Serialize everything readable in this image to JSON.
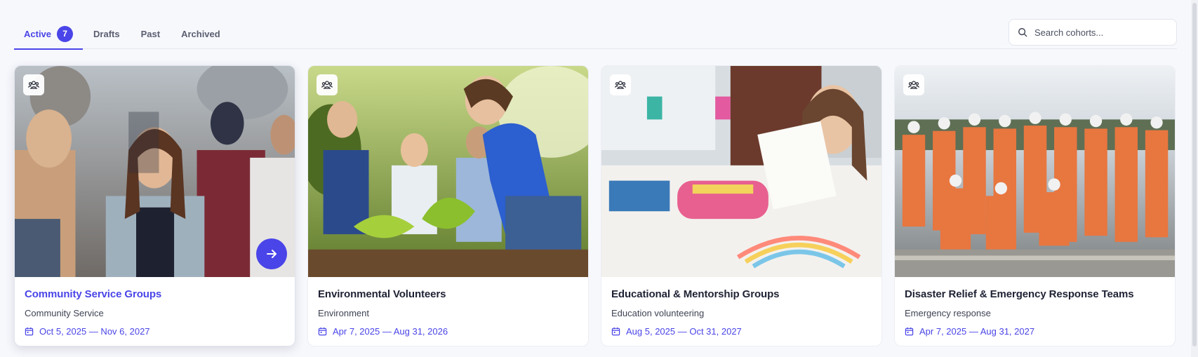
{
  "tabs": [
    {
      "label": "Active",
      "count": "7",
      "active": true
    },
    {
      "label": "Drafts"
    },
    {
      "label": "Past"
    },
    {
      "label": "Archived"
    }
  ],
  "search": {
    "placeholder": "Search cohorts...",
    "icon": "search-icon"
  },
  "cards": [
    {
      "title": "Community Service Groups",
      "category": "Community Service",
      "dates": "Oct 5, 2025 — Nov 6, 2027",
      "image": "crowd-of-volunteers-photo",
      "hovered": true
    },
    {
      "title": "Environmental Volunteers",
      "category": "Environment",
      "dates": "Apr 7, 2025 — Aug 31, 2026",
      "image": "tree-planting-photo"
    },
    {
      "title": "Educational & Mentorship Groups",
      "category": "Education volunteering",
      "dates": "Aug 5, 2025 — Oct 31, 2027",
      "image": "child-drawing-photo"
    },
    {
      "title": "Disaster Relief & Emergency Response Teams",
      "category": "Emergency response",
      "dates": "Apr 7, 2025 — Aug 31, 2027",
      "image": "rescue-team-photo"
    }
  ],
  "colors": {
    "accent": "#4a45e8",
    "background": "#f7f8fc"
  }
}
